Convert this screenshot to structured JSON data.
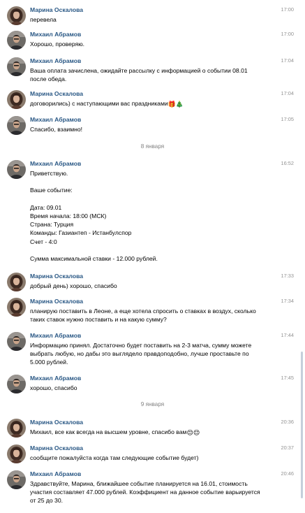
{
  "messages": [
    {
      "author": "Марина Оскалова",
      "avatar": "marina",
      "time": "17:00",
      "text": "перевела"
    },
    {
      "author": "Михаил Абрамов",
      "avatar": "mikhail",
      "time": "17:00",
      "text": "Хорошо, проверяю."
    },
    {
      "author": "Михаил Абрамов",
      "avatar": "mikhail",
      "time": "17:04",
      "text": "Ваша оплата зачислена, ожидайте рассылку с информацией о событии 08.01\nпосле обеда."
    },
    {
      "author": "Марина Оскалова",
      "avatar": "marina",
      "time": "17:04",
      "text": "договорились) с наступающими вас праздниками",
      "emojis": [
        "🎁",
        "🎄"
      ]
    },
    {
      "author": "Михаил Абрамов",
      "avatar": "mikhail",
      "time": "17:05",
      "text": "Спасибо, взаимно!"
    },
    {
      "author": "Михаил Абрамов",
      "avatar": "mikhail",
      "time": "16:52",
      "text": "Приветствую.\n\nВаше событие:\n\nДата: 09.01\nВремя начала: 18:00 (МСК)\nСтрана: Турция\nКоманды: Газиантеп - Истанбулспор\nСчет - 4:0\n\nСумма максимальной ставки - 12.000 рублей."
    },
    {
      "author": "Марина Оскалова",
      "avatar": "marina",
      "time": "17:33",
      "text": "добрый день) хорошо, спасибо"
    },
    {
      "author": "Марина Оскалова",
      "avatar": "marina",
      "time": "17:34",
      "text": "планирую поставить в Леоне, а еще хотела спросить о ставках в воздух, сколько\nтаких ставок нужно поставить и на какую сумму?"
    },
    {
      "author": "Михаил Абрамов",
      "avatar": "mikhail",
      "time": "17:44",
      "text": "Информацию принял. Достаточно будет поставить на 2-3 матча, сумму можете\nвыбрать любую, но дабы это выглядело правдоподобно, лучше проставьте по\n5.000 рублей."
    },
    {
      "author": "Михаил Абрамов",
      "avatar": "mikhail",
      "time": "17:45",
      "text": "хорошо, спасибо"
    },
    {
      "author": "Марина Оскалова",
      "avatar": "marina",
      "time": "20:36",
      "text": "Михаил, все как всегда на высшем уровне, спасибо вам",
      "emojis": [
        "😌",
        "😌"
      ]
    },
    {
      "author": "Марина Оскалова",
      "avatar": "marina",
      "time": "20:37",
      "text": "сообщите пожалуйста когда там следующие событие будет)"
    },
    {
      "author": "Михаил Абрамов",
      "avatar": "mikhail",
      "time": "20:46",
      "text": "Здравствуйте, Марина, ближайшее событие планируется на 16.01, стоимость\nучастия составляет 47.000 рублей. Коэффициент на данное событие варьируется\nот 25 до 30."
    }
  ],
  "date_separators": [
    "8 января",
    "9 января"
  ],
  "colors": {
    "author": "#2a5885",
    "time": "#939393",
    "separator": "#828282",
    "scrollbar": "#c5cfdb"
  }
}
